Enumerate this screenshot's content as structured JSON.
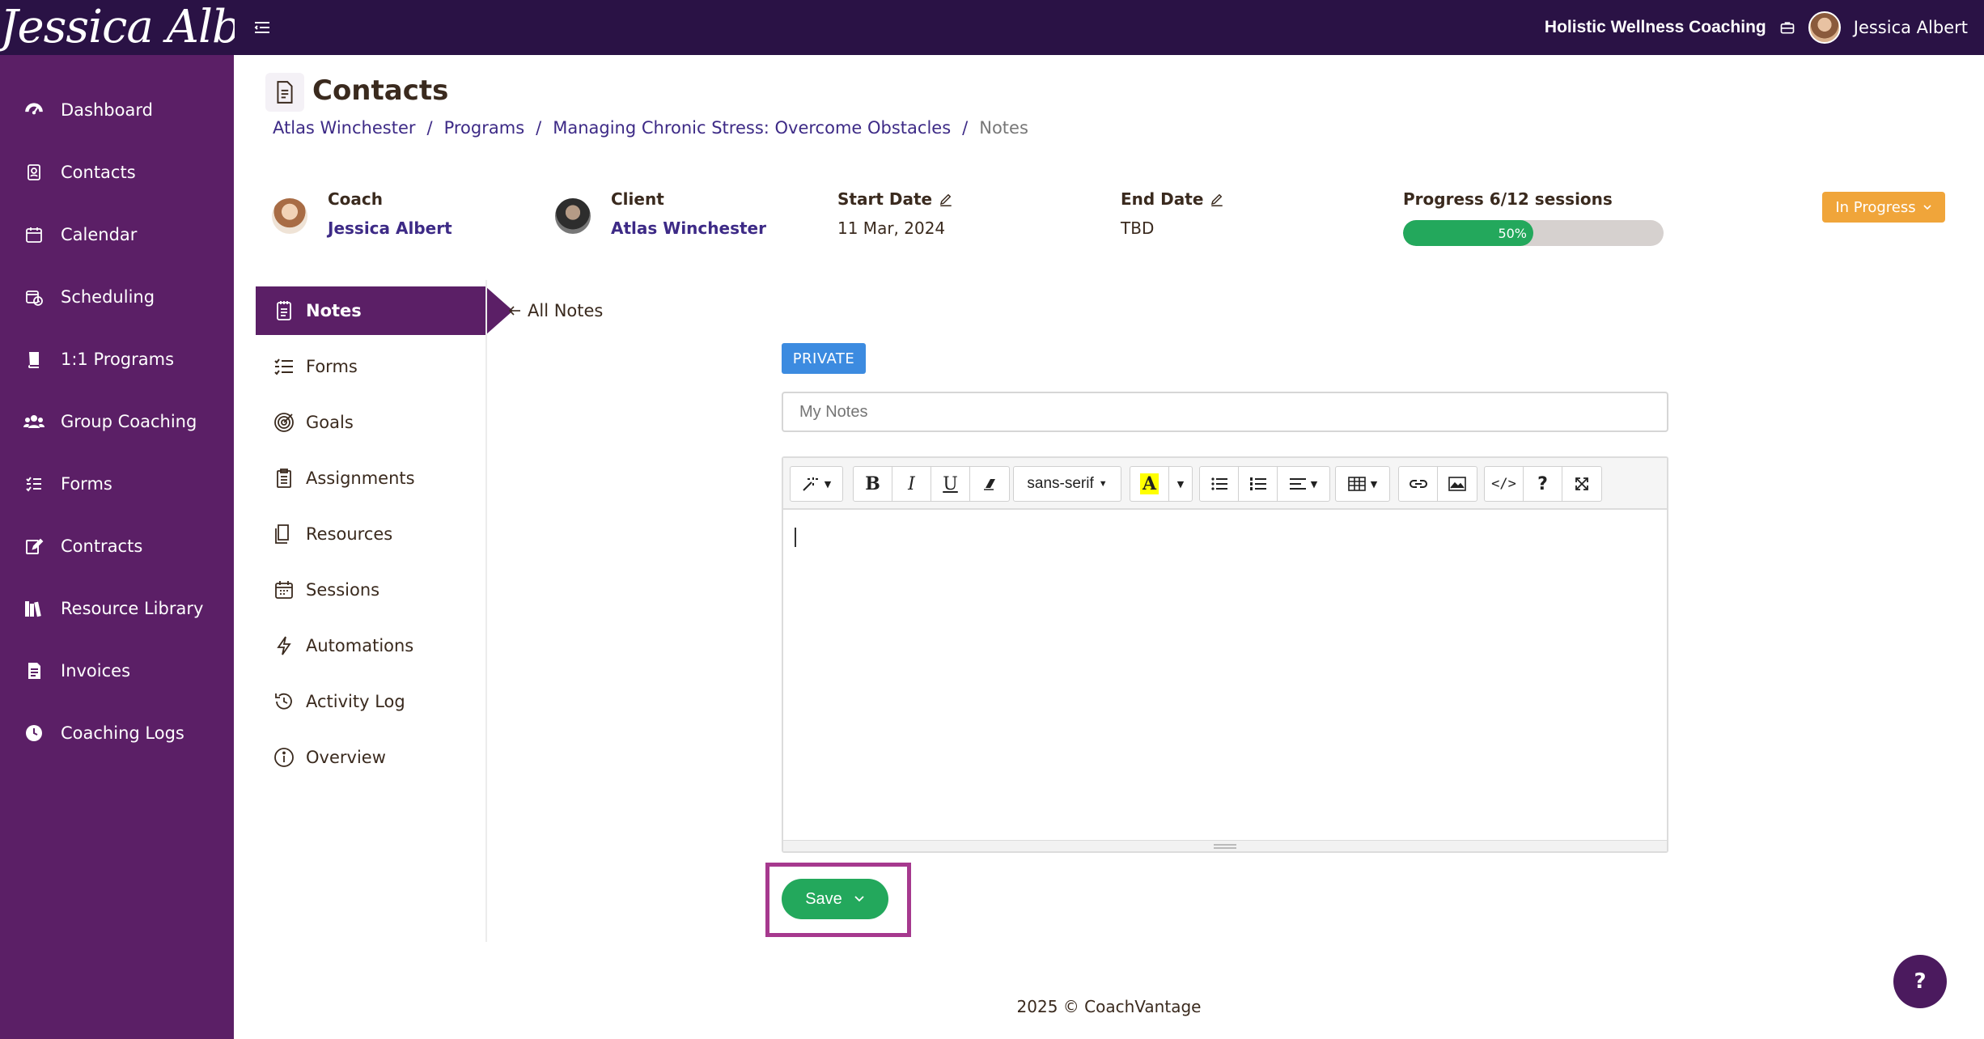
{
  "brand": {
    "logo_text": "Jessica Albert"
  },
  "topbar": {
    "business_name": "Holistic Wellness Coaching",
    "user_name": "Jessica Albert"
  },
  "sidebar": {
    "items": [
      {
        "label": "Dashboard",
        "icon": "dashboard-icon"
      },
      {
        "label": "Contacts",
        "icon": "contacts-icon"
      },
      {
        "label": "Calendar",
        "icon": "calendar-icon"
      },
      {
        "label": "Scheduling",
        "icon": "scheduling-icon"
      },
      {
        "label": "1:1 Programs",
        "icon": "book-icon"
      },
      {
        "label": "Group Coaching",
        "icon": "group-icon"
      },
      {
        "label": "Forms",
        "icon": "forms-icon"
      },
      {
        "label": "Contracts",
        "icon": "contract-icon"
      },
      {
        "label": "Resource Library",
        "icon": "library-icon"
      },
      {
        "label": "Invoices",
        "icon": "invoice-icon"
      },
      {
        "label": "Coaching Logs",
        "icon": "clock-icon"
      }
    ]
  },
  "page": {
    "title": "Contacts",
    "breadcrumb": [
      "Atlas Winchester",
      "Programs",
      "Managing Chronic Stress: Overcome Obstacles",
      "Notes"
    ],
    "breadcrumb_sep": "/"
  },
  "program_info": {
    "coach_label": "Coach",
    "coach_name": "Jessica Albert",
    "client_label": "Client",
    "client_name": "Atlas Winchester",
    "start_label": "Start Date",
    "start_value": "11 Mar, 2024",
    "end_label": "End Date",
    "end_value": "TBD",
    "progress_label": "Progress 6/12 sessions",
    "progress_text": "50%",
    "progress_fraction": 0.5,
    "status_label": "In Progress",
    "status_color": "#f0a53a",
    "progress_color": "#23a85c"
  },
  "subnav": {
    "items": [
      {
        "label": "Notes",
        "icon": "notes-icon"
      },
      {
        "label": "Forms",
        "icon": "checklist-icon"
      },
      {
        "label": "Goals",
        "icon": "target-icon"
      },
      {
        "label": "Assignments",
        "icon": "clipboard-icon"
      },
      {
        "label": "Resources",
        "icon": "document-icon"
      },
      {
        "label": "Sessions",
        "icon": "calendar-icon"
      },
      {
        "label": "Automations",
        "icon": "lightning-icon"
      },
      {
        "label": "Activity Log",
        "icon": "history-icon"
      },
      {
        "label": "Overview",
        "icon": "info-icon"
      }
    ],
    "active": "Notes"
  },
  "note_editor": {
    "back_label": "All Notes",
    "visibility_badge": "PRIVATE",
    "title_placeholder": "My Notes",
    "font_family_label": "sans-serif",
    "save_label": "Save"
  },
  "footer": {
    "text": "2025 © CoachVantage"
  },
  "help": {
    "label": "?"
  },
  "colors": {
    "sidebar": "#5b1f66",
    "topbar": "#2a1245",
    "accent_link": "#3d2a86",
    "private_badge": "#3c8be0",
    "highlight": "#a6398e"
  }
}
